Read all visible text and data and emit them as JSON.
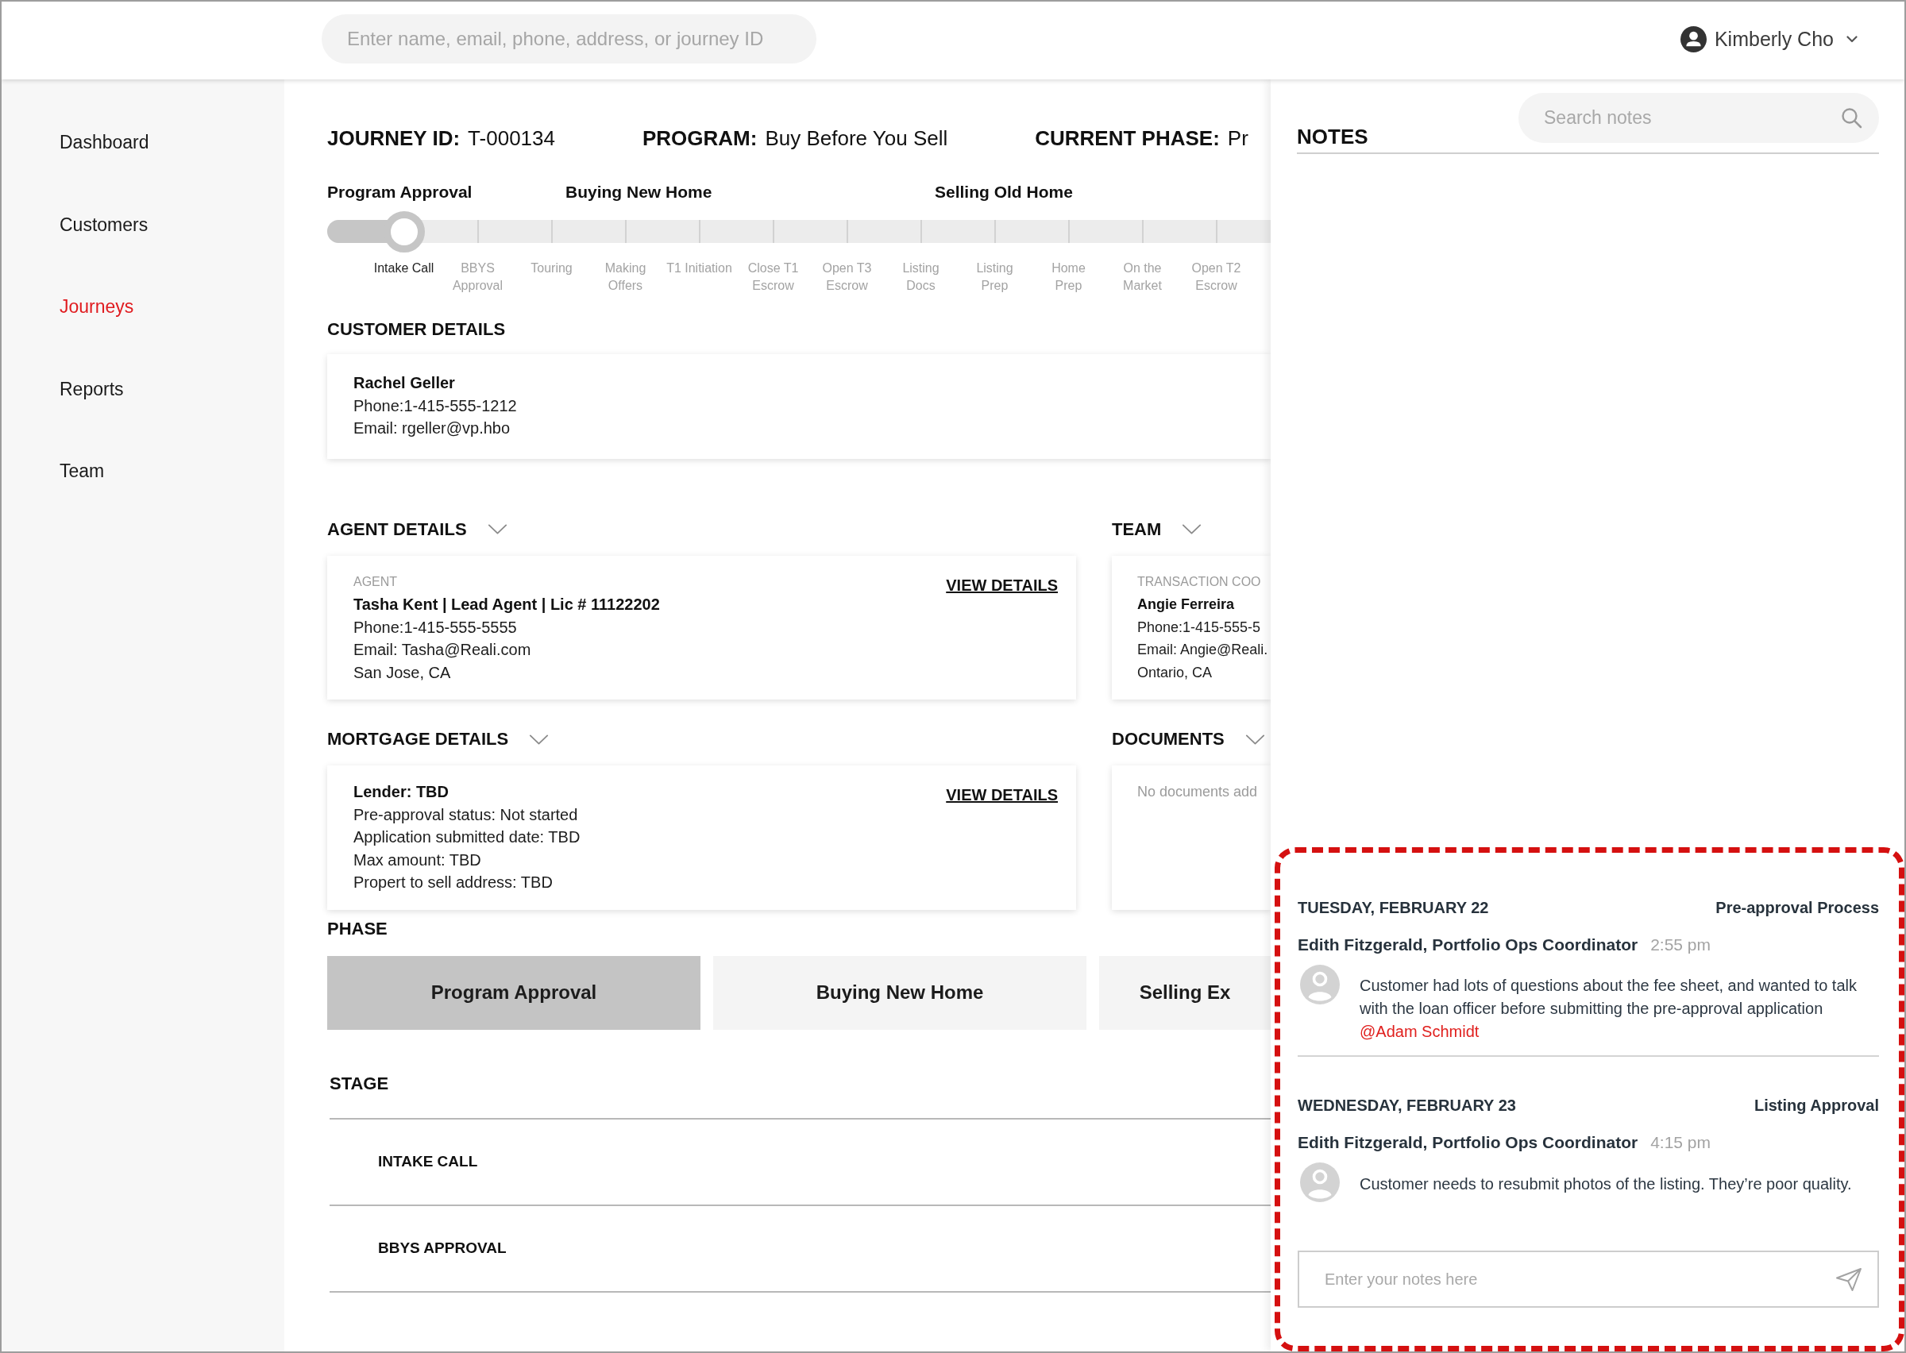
{
  "header": {
    "search": {
      "placeholder": "Enter name, email, phone, address, or journey ID"
    },
    "user": {
      "name": "Kimberly Cho"
    }
  },
  "sidebar": {
    "items": [
      {
        "label": "Dashboard",
        "selected": false
      },
      {
        "label": "Customers",
        "selected": false
      },
      {
        "label": "Journeys",
        "selected": true
      },
      {
        "label": "Reports",
        "selected": false
      },
      {
        "label": "Team",
        "selected": false
      }
    ]
  },
  "journey": {
    "fields": [
      {
        "label": "JOURNEY ID:",
        "value": "T-000134"
      },
      {
        "label": "PROGRAM:",
        "value": "Buy Before You Sell"
      },
      {
        "label": "CURRENT PHASE:",
        "value": "Pr"
      }
    ]
  },
  "progress": {
    "phases": [
      {
        "label": "Program Approval",
        "stages": [
          {
            "label": "Intake Call",
            "current": true
          },
          {
            "label": "BBYS\nApproval",
            "current": false
          }
        ]
      },
      {
        "label": "Buying New Home",
        "stages": [
          {
            "label": "Touring",
            "current": false
          },
          {
            "label": "Making\nOffers",
            "current": false
          },
          {
            "label": "T1 Initiation",
            "current": false
          },
          {
            "label": "Close T1\nEscrow",
            "current": false
          },
          {
            "label": "Open T3\nEscrow",
            "current": false
          }
        ]
      },
      {
        "label": "Selling Old Home",
        "stages": [
          {
            "label": "Listing\nDocs",
            "current": false
          },
          {
            "label": "Listing\nPrep",
            "current": false
          },
          {
            "label": "Home\nPrep",
            "current": false
          },
          {
            "label": "On the\nMarket",
            "current": false
          },
          {
            "label": "Open T2\nEscrow",
            "current": false
          }
        ]
      }
    ]
  },
  "customer": {
    "title": "CUSTOMER DETAILS",
    "name": "Rachel Geller",
    "lines": [
      "Phone:1-415-555-1212",
      "Email: rgeller@vp.hbo"
    ]
  },
  "details": [
    {
      "title": "AGENT DETAILS",
      "caption": "AGENT",
      "name": "Tasha Kent | Lead Agent | Lic # 11122202",
      "lines": [
        "Phone:1-415-555-5555",
        "Email: Tasha@Reali.com",
        "San Jose, CA"
      ],
      "link": "VIEW DETAILS"
    },
    {
      "title": "TEAM",
      "caption": "TRANSACTION COO",
      "name": "Angie Ferreira",
      "lines": [
        "Phone:1-415-555-5",
        "Email: Angie@Reali.",
        "Ontario, CA"
      ]
    },
    {
      "title": "MORTGAGE DETAILS",
      "name": "Lender: TBD",
      "lines": [
        "Pre-approval status: Not started",
        "Application submitted date: TBD",
        "Max amount: TBD",
        "Propert to sell address: TBD"
      ],
      "link": "VIEW DETAILS"
    },
    {
      "title": "DOCUMENTS",
      "empty_text": "No documents add"
    }
  ],
  "phase": {
    "title": "PHASE",
    "tabs": [
      {
        "label": "Program Approval",
        "selected": true
      },
      {
        "label": "Buying New Home",
        "selected": false
      },
      {
        "label": "Selling Ex",
        "selected": false
      }
    ]
  },
  "stage": {
    "title": "STAGE",
    "rows": [
      {
        "label": "INTAKE CALL"
      },
      {
        "label": "BBYS APPROVAL"
      }
    ]
  },
  "notes": {
    "title": "NOTES",
    "search": {
      "placeholder": "Search notes"
    },
    "highlighted": true,
    "entries": [
      {
        "date": "TUESDAY, FEBRUARY 22",
        "category": "Pre-approval Process",
        "author": "Edith Fitzgerald, Portfolio Ops Coordinator",
        "time": "2:55 pm",
        "text": "Customer had lots of questions about the fee sheet, and wanted to talk with the loan officer before submitting the pre-approval application",
        "mention": "@Adam Schmidt"
      },
      {
        "date": "WEDNESDAY, FEBRUARY 23",
        "category": "Listing Approval",
        "author": "Edith Fitzgerald, Portfolio Ops Coordinator",
        "time": "4:15 pm",
        "text": "Customer needs to resubmit photos of the listing. They’re poor quality."
      }
    ],
    "composer": {
      "placeholder": "Enter your notes here"
    }
  }
}
